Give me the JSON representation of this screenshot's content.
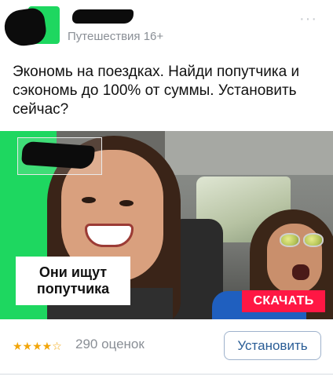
{
  "post": {
    "category": "Путешествия 16+",
    "more_icon": "···",
    "text": "Экономь на поездках. Найди попутчика и сэкономь до 100% от суммы. Установить сейчас?"
  },
  "ad": {
    "caption": "Они ищут попутчика",
    "cta": "СКАЧАТЬ",
    "accent_color": "#1ed760",
    "cta_color": "#ff1744"
  },
  "footer": {
    "stars": "★★★★☆",
    "rating": 4,
    "rating_count": "290 оценок",
    "install_label": "Установить"
  }
}
